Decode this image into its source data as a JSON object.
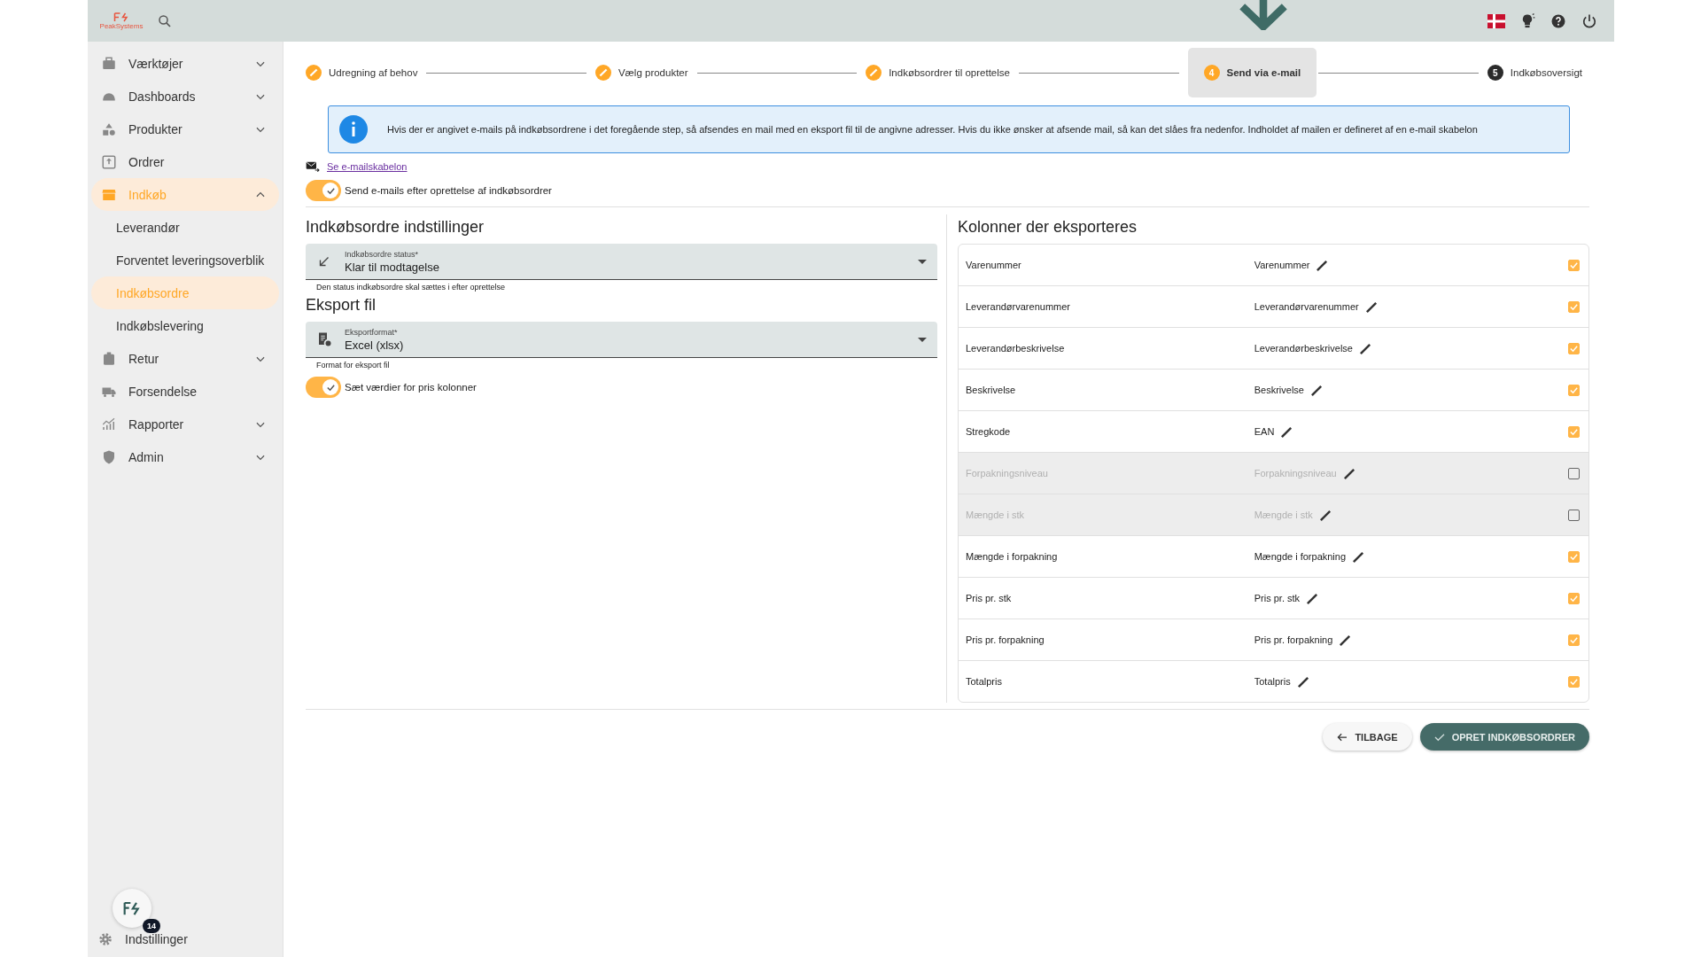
{
  "header": {
    "logo_text": "PeakSystems"
  },
  "sidebar": {
    "items": [
      {
        "label": "Værktøjer",
        "expanded": false,
        "selected": false
      },
      {
        "label": "Dashboards",
        "expanded": false,
        "selected": false
      },
      {
        "label": "Produkter",
        "expanded": false,
        "selected": false
      },
      {
        "label": "Ordrer",
        "selected": false
      },
      {
        "label": "Indkøb",
        "expanded": true,
        "selected": true,
        "children": [
          {
            "label": "Leverandør",
            "selected": false
          },
          {
            "label": "Forventet leveringsoverblik",
            "selected": false
          },
          {
            "label": "Indkøbsordre",
            "selected": true
          },
          {
            "label": "Indkøbslevering",
            "selected": false
          }
        ]
      },
      {
        "label": "Retur",
        "expanded": false,
        "selected": false
      },
      {
        "label": "Forsendelse",
        "selected": false
      },
      {
        "label": "Rapporter",
        "expanded": false,
        "selected": false
      },
      {
        "label": "Admin",
        "expanded": false,
        "selected": false
      }
    ],
    "settings": "Indstillinger",
    "notification_count": "14"
  },
  "stepper": [
    {
      "label": "Udregning af behov",
      "kind": "done",
      "selected": false
    },
    {
      "label": "Vælg produkter",
      "kind": "done",
      "selected": false
    },
    {
      "label": "Indkøbsordrer til oprettelse",
      "kind": "done",
      "selected": false
    },
    {
      "label": "Send via e-mail",
      "kind": "current",
      "number": "4",
      "selected": true
    },
    {
      "label": "Indkøbsoversigt",
      "kind": "pending",
      "number": "5",
      "selected": false
    }
  ],
  "info": "Hvis der er angivet e-mails på indkøbsordrene i det foregående step, så afsendes en mail med en eksport fil til de angivne adresser. Hvis du ikke ønsker at afsende mail, så kan det slåes fra nedenfor. Indholdet af mailen er defineret af en e-mail skabelon",
  "template_link": "Se e-mailskabelon",
  "send_toggle": {
    "label": "Send e-mails efter oprettelse af indkøbsordrer",
    "on": true
  },
  "settings_section": {
    "title": "Indkøbsordre indstillinger",
    "status_field": {
      "label": "Indkøbsordre status*",
      "value": "Klar til modtagelse",
      "hint": "Den status indkøbsordre skal sættes i efter oprettelse"
    }
  },
  "export_section": {
    "title": "Eksport fil",
    "format_field": {
      "label": "Eksportformat*",
      "value": "Excel (xlsx)",
      "hint": "Format for eksport fil"
    },
    "price_toggle": {
      "label": "Sæt værdier for pris kolonner",
      "on": true
    }
  },
  "columns_section": {
    "title": "Kolonner der eksporteres",
    "rows": [
      {
        "name": "Varenummer",
        "export_name": "Varenummer",
        "checked": true
      },
      {
        "name": "Leverandørvarenummer",
        "export_name": "Leverandørvarenummer",
        "checked": true
      },
      {
        "name": "Leverandørbeskrivelse",
        "export_name": "Leverandørbeskrivelse",
        "checked": true
      },
      {
        "name": "Beskrivelse",
        "export_name": "Beskrivelse",
        "checked": true
      },
      {
        "name": "Stregkode",
        "export_name": "EAN",
        "checked": true
      },
      {
        "name": "Forpakningsniveau",
        "export_name": "Forpakningsniveau",
        "checked": false
      },
      {
        "name": "Mængde i stk",
        "export_name": "Mængde i stk",
        "checked": false
      },
      {
        "name": "Mængde i forpakning",
        "export_name": "Mængde i forpakning",
        "checked": true
      },
      {
        "name": "Pris pr. stk",
        "export_name": "Pris pr. stk",
        "checked": true
      },
      {
        "name": "Pris pr. forpakning",
        "export_name": "Pris pr. forpakning",
        "checked": true
      },
      {
        "name": "Totalpris",
        "export_name": "Totalpris",
        "checked": true
      }
    ]
  },
  "buttons": {
    "back": "TILBAGE",
    "create": "OPRET INDKØBSORDRER"
  }
}
